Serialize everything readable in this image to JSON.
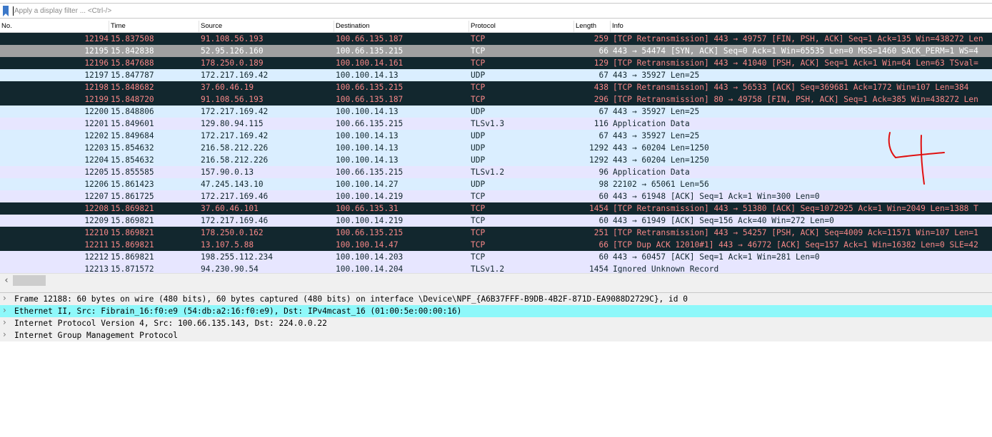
{
  "filter": {
    "placeholder": "Apply a display filter ... <Ctrl-/>",
    "value": ""
  },
  "columns": {
    "no": "No.",
    "time": "Time",
    "source": "Source",
    "destination": "Destination",
    "protocol": "Protocol",
    "length": "Length",
    "info": "Info"
  },
  "colors": {
    "tcp_error_bg": "#12272e",
    "tcp_error_fg": "#f78787",
    "selected_bg": "#a0a0a0",
    "selected_fg": "#ffffff",
    "udp_bg": "#daeeff",
    "tcp_bg": "#e7e6ff",
    "text_fg": "#12272e",
    "detail_highlight_bg": "#8ef8fa",
    "detail_bg": "#f0f0f0"
  },
  "packets": [
    {
      "no": "12194",
      "time": "15.837508",
      "source": "91.108.56.193",
      "destination": "100.66.135.187",
      "protocol": "TCP",
      "length": "259",
      "info": "[TCP Retransmission] 443 → 49757 [FIN, PSH, ACK] Seq=1 Ack=135 Win=438272 Len",
      "style": "error"
    },
    {
      "no": "12195",
      "time": "15.842838",
      "source": "52.95.126.160",
      "destination": "100.66.135.215",
      "protocol": "TCP",
      "length": "66",
      "info": "443 → 54474 [SYN, ACK] Seq=0 Ack=1 Win=65535 Len=0 MSS=1460 SACK_PERM=1 WS=4",
      "style": "selected"
    },
    {
      "no": "12196",
      "time": "15.847688",
      "source": "178.250.0.189",
      "destination": "100.100.14.161",
      "protocol": "TCP",
      "length": "129",
      "info": "[TCP Retransmission] 443 → 41040 [PSH, ACK] Seq=1 Ack=1 Win=64 Len=63 TSval=",
      "style": "error"
    },
    {
      "no": "12197",
      "time": "15.847787",
      "source": "172.217.169.42",
      "destination": "100.100.14.13",
      "protocol": "UDP",
      "length": "67",
      "info": "443 → 35927 Len=25",
      "style": "udp"
    },
    {
      "no": "12198",
      "time": "15.848682",
      "source": "37.60.46.19",
      "destination": "100.66.135.215",
      "protocol": "TCP",
      "length": "438",
      "info": "[TCP Retransmission] 443 → 56533 [ACK] Seq=369681 Ack=1772 Win=107 Len=384",
      "style": "error"
    },
    {
      "no": "12199",
      "time": "15.848720",
      "source": "91.108.56.193",
      "destination": "100.66.135.187",
      "protocol": "TCP",
      "length": "296",
      "info": "[TCP Retransmission] 80 → 49758 [FIN, PSH, ACK] Seq=1 Ack=385 Win=438272 Len",
      "style": "error"
    },
    {
      "no": "12200",
      "time": "15.848806",
      "source": "172.217.169.42",
      "destination": "100.100.14.13",
      "protocol": "UDP",
      "length": "67",
      "info": "443 → 35927 Len=25",
      "style": "udp"
    },
    {
      "no": "12201",
      "time": "15.849601",
      "source": "129.80.94.115",
      "destination": "100.66.135.215",
      "protocol": "TLSv1.3",
      "length": "116",
      "info": "Application Data",
      "style": "tcp"
    },
    {
      "no": "12202",
      "time": "15.849684",
      "source": "172.217.169.42",
      "destination": "100.100.14.13",
      "protocol": "UDP",
      "length": "67",
      "info": "443 → 35927 Len=25",
      "style": "udp"
    },
    {
      "no": "12203",
      "time": "15.854632",
      "source": "216.58.212.226",
      "destination": "100.100.14.13",
      "protocol": "UDP",
      "length": "1292",
      "info": "443 → 60204 Len=1250",
      "style": "udp"
    },
    {
      "no": "12204",
      "time": "15.854632",
      "source": "216.58.212.226",
      "destination": "100.100.14.13",
      "protocol": "UDP",
      "length": "1292",
      "info": "443 → 60204 Len=1250",
      "style": "udp"
    },
    {
      "no": "12205",
      "time": "15.855585",
      "source": "157.90.0.13",
      "destination": "100.66.135.215",
      "protocol": "TLSv1.2",
      "length": "96",
      "info": "Application Data",
      "style": "tcp"
    },
    {
      "no": "12206",
      "time": "15.861423",
      "source": "47.245.143.10",
      "destination": "100.100.14.27",
      "protocol": "UDP",
      "length": "98",
      "info": "22102 → 65061 Len=56",
      "style": "udp"
    },
    {
      "no": "12207",
      "time": "15.861725",
      "source": "172.217.169.46",
      "destination": "100.100.14.219",
      "protocol": "TCP",
      "length": "60",
      "info": "443 → 61948 [ACK] Seq=1 Ack=1 Win=300 Len=0",
      "style": "tcp"
    },
    {
      "no": "12208",
      "time": "15.869821",
      "source": "37.60.46.101",
      "destination": "100.66.135.31",
      "protocol": "TCP",
      "length": "1454",
      "info": "[TCP Retransmission] 443 → 51380 [ACK] Seq=1072925 Ack=1 Win=2049 Len=1388 T",
      "style": "error"
    },
    {
      "no": "12209",
      "time": "15.869821",
      "source": "172.217.169.46",
      "destination": "100.100.14.219",
      "protocol": "TCP",
      "length": "60",
      "info": "443 → 61949 [ACK] Seq=156 Ack=40 Win=272 Len=0",
      "style": "tcp"
    },
    {
      "no": "12210",
      "time": "15.869821",
      "source": "178.250.0.162",
      "destination": "100.66.135.215",
      "protocol": "TCP",
      "length": "251",
      "info": "[TCP Retransmission] 443 → 54257 [PSH, ACK] Seq=4009 Ack=11571 Win=107 Len=1",
      "style": "error"
    },
    {
      "no": "12211",
      "time": "15.869821",
      "source": "13.107.5.88",
      "destination": "100.100.14.47",
      "protocol": "TCP",
      "length": "66",
      "info": "[TCP Dup ACK 12010#1] 443 → 46772 [ACK] Seq=157 Ack=1 Win=16382 Len=0 SLE=42",
      "style": "error"
    },
    {
      "no": "12212",
      "time": "15.869821",
      "source": "198.255.112.234",
      "destination": "100.100.14.203",
      "protocol": "TCP",
      "length": "60",
      "info": "443 → 60457 [ACK] Seq=1 Ack=1 Win=281 Len=0",
      "style": "tcp"
    },
    {
      "no": "12213",
      "time": "15.871572",
      "source": "94.230.90.54",
      "destination": "100.100.14.204",
      "protocol": "TLSv1.2",
      "length": "1454",
      "info": "Ignored Unknown Record",
      "style": "tcp"
    }
  ],
  "details": [
    {
      "text": "Frame 12188: 60 bytes on wire (480 bits), 60 bytes captured (480 bits) on interface \\Device\\NPF_{A6B37FFF-B9DB-4B2F-871D-EA9088D2729C}, id 0",
      "highlight": false
    },
    {
      "text": "Ethernet II, Src: Fibrain_16:f0:e9 (54:db:a2:16:f0:e9), Dst: IPv4mcast_16 (01:00:5e:00:00:16)",
      "highlight": true
    },
    {
      "text": "Internet Protocol Version 4, Src: 100.66.135.143, Dst: 224.0.0.22",
      "highlight": false
    },
    {
      "text": "Internet Group Management Protocol",
      "highlight": false
    }
  ]
}
